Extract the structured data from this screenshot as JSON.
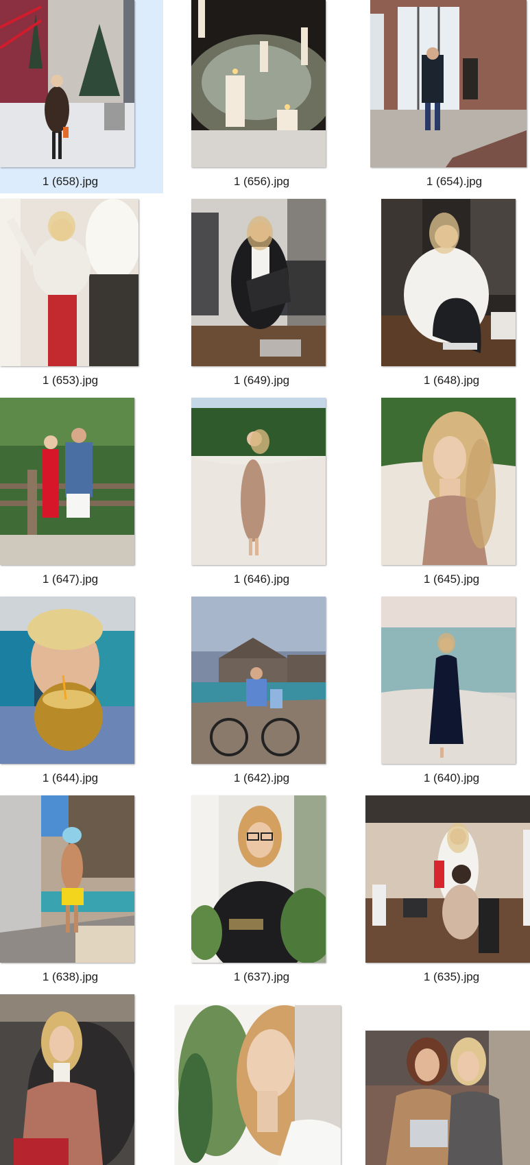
{
  "selected_index": 0,
  "files": [
    {
      "name": "1 (658).jpg",
      "scene": "woman-in-fur-coat-on-snowy-street"
    },
    {
      "name": "1 (656).jpg",
      "scene": "candles-and-pine-centerpiece"
    },
    {
      "name": "1 (654).jpg",
      "scene": "man-in-brick-loft-under-renovation"
    },
    {
      "name": "1 (653).jpg",
      "scene": "woman-in-white-sweater-red-trousers"
    },
    {
      "name": "1 (649).jpg",
      "scene": "woman-holding-photo-book"
    },
    {
      "name": "1 (648).jpg",
      "scene": "woman-with-black-folder"
    },
    {
      "name": "1 (647).jpg",
      "scene": "couple-on-wooden-deck"
    },
    {
      "name": "1 (646).jpg",
      "scene": "girl-on-white-sand"
    },
    {
      "name": "1 (645).jpg",
      "scene": "girl-portrait-on-beach"
    },
    {
      "name": "1 (644).jpg",
      "scene": "boy-drinking-from-coconut"
    },
    {
      "name": "1 (642).jpg",
      "scene": "man-and-boy-on-bicycle"
    },
    {
      "name": "1 (640).jpg",
      "scene": "woman-in-long-dress-at-sea"
    },
    {
      "name": "1 (638).jpg",
      "scene": "boy-with-snorkel-mask"
    },
    {
      "name": "1 (637).jpg",
      "scene": "woman-in-glasses-office"
    },
    {
      "name": "1 (635).jpg",
      "scene": "two-women-at-computer"
    },
    {
      "name": "",
      "scene": "woman-in-armchair"
    },
    {
      "name": "",
      "scene": "woman-profile-eyes-closed"
    },
    {
      "name": "",
      "scene": "two-women-with-laptop"
    }
  ]
}
